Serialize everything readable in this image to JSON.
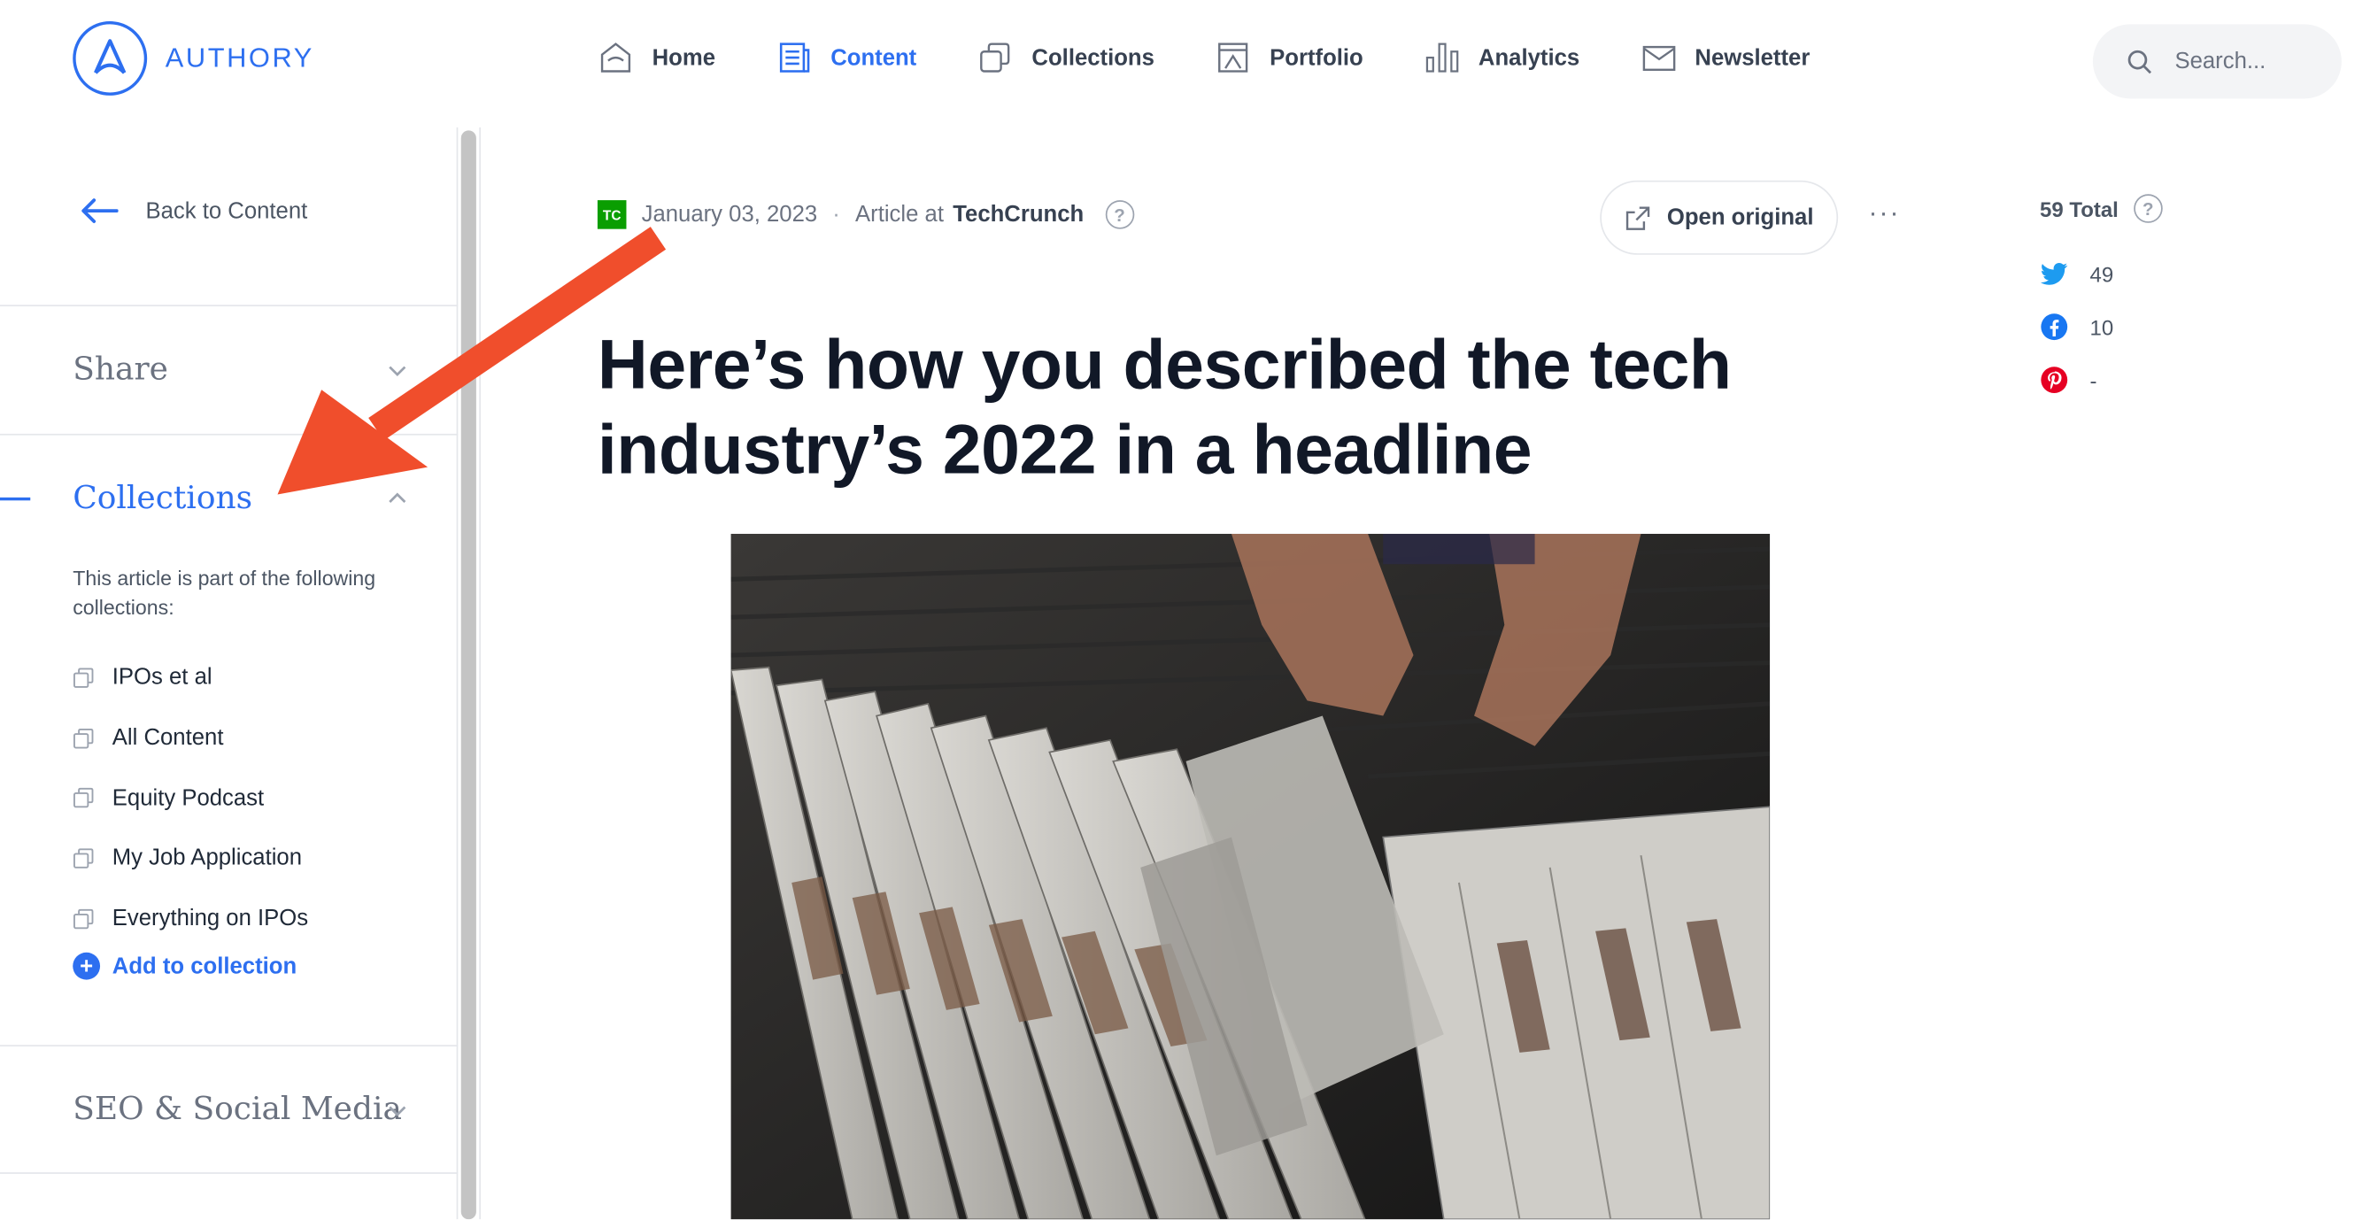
{
  "app": {
    "logo_text": "AUTHORY"
  },
  "nav": {
    "items": [
      {
        "label": "Home",
        "icon": "home-icon",
        "active": false
      },
      {
        "label": "Content",
        "icon": "content-icon",
        "active": true
      },
      {
        "label": "Collections",
        "icon": "collections-icon",
        "active": false
      },
      {
        "label": "Portfolio",
        "icon": "portfolio-icon",
        "active": false
      },
      {
        "label": "Analytics",
        "icon": "analytics-icon",
        "active": false
      },
      {
        "label": "Newsletter",
        "icon": "newsletter-icon",
        "active": false
      }
    ]
  },
  "search": {
    "placeholder": "Search..."
  },
  "sidebar": {
    "back_label": "Back to Content",
    "share_title": "Share",
    "collections_title": "Collections",
    "collections_desc": "This article is part of the following collections:",
    "collections": [
      "IPOs et al",
      "All Content",
      "Equity Podcast",
      "My Job Application",
      "Everything on IPOs"
    ],
    "add_label": "Add to collection",
    "seo_title": "SEO & Social Media"
  },
  "article": {
    "date": "January 03, 2023",
    "separator": "·",
    "type_prefix": "Article at",
    "publication": "TechCrunch",
    "publication_badge": "TC",
    "open_original_label": "Open original",
    "more_label": "···",
    "headline": "Here’s how you described the tech industry’s 2022 in a headline"
  },
  "stats": {
    "total_label": "59 Total",
    "twitter": "49",
    "facebook": "10",
    "pinterest": "-"
  },
  "colors": {
    "accent": "#2d6ff0",
    "arrow": "#f04e2c",
    "twitter": "#1d9bf0",
    "facebook": "#1877f2",
    "pinterest": "#e60023",
    "techcrunch": "#0a9e01"
  }
}
